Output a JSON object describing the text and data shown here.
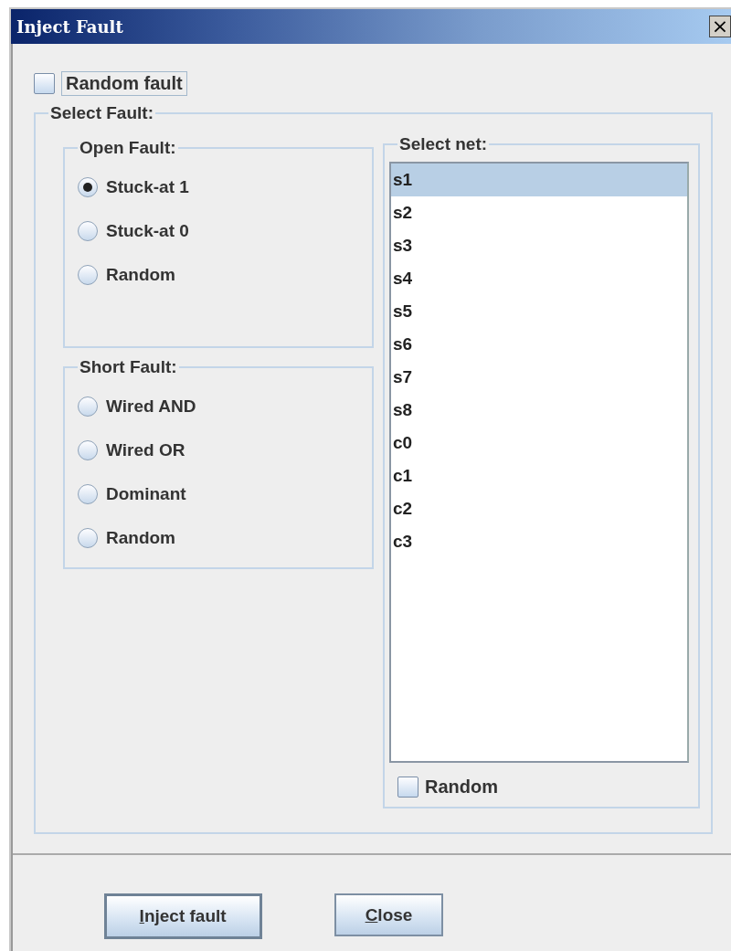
{
  "window": {
    "title": "Inject Fault",
    "close_glyph": "×"
  },
  "random_fault": {
    "label": "Random fault",
    "checked": false
  },
  "select_fault": {
    "title": "Select Fault:",
    "open_fault": {
      "title": "Open Fault:",
      "options": [
        {
          "label": "Stuck-at 1",
          "selected": true
        },
        {
          "label": "Stuck-at 0",
          "selected": false
        },
        {
          "label": "Random",
          "selected": false
        }
      ]
    },
    "short_fault": {
      "title": "Short Fault:",
      "options": [
        {
          "label": "Wired AND",
          "selected": false
        },
        {
          "label": "Wired OR",
          "selected": false
        },
        {
          "label": "Dominant",
          "selected": false
        },
        {
          "label": "Random",
          "selected": false
        }
      ]
    },
    "select_net": {
      "title": "Select net:",
      "items": [
        {
          "label": "s1",
          "selected": true
        },
        {
          "label": "s2",
          "selected": false
        },
        {
          "label": "s3",
          "selected": false
        },
        {
          "label": "s4",
          "selected": false
        },
        {
          "label": "s5",
          "selected": false
        },
        {
          "label": "s6",
          "selected": false
        },
        {
          "label": "s7",
          "selected": false
        },
        {
          "label": "s8",
          "selected": false
        },
        {
          "label": "c0",
          "selected": false
        },
        {
          "label": "c1",
          "selected": false
        },
        {
          "label": "c2",
          "selected": false
        },
        {
          "label": "c3",
          "selected": false
        }
      ],
      "random": {
        "label": "Random",
        "checked": false
      }
    }
  },
  "buttons": [
    {
      "label": "Inject fault",
      "mnemonic_underlined": true,
      "default": true
    },
    {
      "label": "Close",
      "mnemonic_underlined": true,
      "default": false
    }
  ]
}
